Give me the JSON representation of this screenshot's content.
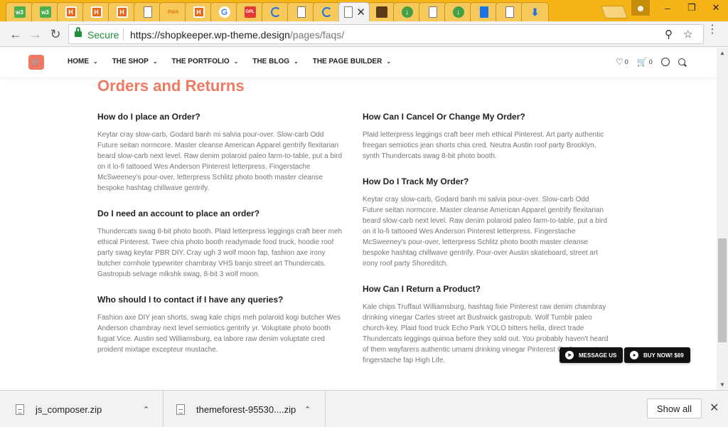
{
  "browser": {
    "tabs": [
      {
        "icon": "w3schools-icon",
        "text": "w3"
      },
      {
        "icon": "w3schools-icon",
        "text": "w3"
      },
      {
        "icon": "html-icon",
        "text": "H"
      },
      {
        "icon": "html-icon",
        "text": "H"
      },
      {
        "icon": "html-icon",
        "text": "H"
      },
      {
        "icon": "document-icon",
        "text": ""
      },
      {
        "icon": "phpmyadmin-icon",
        "text": "PMA"
      },
      {
        "icon": "html-icon",
        "text": "H"
      },
      {
        "icon": "google-icon",
        "text": "G"
      },
      {
        "icon": "gpl-icon",
        "text": "GPL"
      },
      {
        "icon": "loading-icon",
        "text": ""
      },
      {
        "icon": "document-icon",
        "text": ""
      },
      {
        "icon": "loading-icon",
        "text": ""
      },
      {
        "icon": "page-icon",
        "text": "f"
      },
      {
        "icon": "image-icon",
        "text": ""
      },
      {
        "icon": "download-icon",
        "text": "↓"
      },
      {
        "icon": "document-icon",
        "text": ""
      },
      {
        "icon": "download-icon",
        "text": "↓"
      },
      {
        "icon": "docs-icon",
        "text": ""
      },
      {
        "icon": "document-icon",
        "text": ""
      },
      {
        "icon": "arrow-down-icon",
        "text": "⬇"
      }
    ],
    "active_tab_text": "f",
    "address": {
      "secure_label": "Secure",
      "url_host": "https://shopkeeper.wp-theme.design",
      "url_path": "/pages/faqs/"
    }
  },
  "site": {
    "logo_icon": "cart-icon",
    "nav": [
      {
        "label": "HOME"
      },
      {
        "label": "THE SHOP"
      },
      {
        "label": "THE PORTFOLIO"
      },
      {
        "label": "THE BLOG"
      },
      {
        "label": "THE PAGE BUILDER"
      }
    ],
    "wishlist_count": "0",
    "cart_count": "0"
  },
  "content": {
    "section_title": "Orders and Returns",
    "left_faqs": [
      {
        "q": "How do I place an Order?",
        "a": "Keytar cray slow-carb, Godard banh mi salvia pour-over. Slow-carb Odd Future seitan normcore. Master cleanse American Apparel gentrify flexitarian beard slow-carb next level. Raw denim polaroid paleo farm-to-table, put a bird on it lo-fi tattooed Wes Anderson Pinterest letterpress. Fingerstache McSweeney's pour-over, letterpress Schlitz photo booth master cleanse bespoke hashtag chillwave gentrify."
      },
      {
        "q": "Do I need an account to place an order?",
        "a": "Thundercats swag 8-bit photo booth. Plaid letterpress leggings craft beer meh ethical Pinterest. Twee chia photo booth readymade food truck, hoodie roof party swag keytar PBR DIY. Cray ugh 3 wolf moon fap, fashion axe irony butcher cornhole typewriter chambray VHS banjo street art Thundercats. Gastropub selvage mlkshk swag, 8-bit 3 wolf moon."
      },
      {
        "q": "Who should I to contact if I have any queries?",
        "a": "Fashion axe DIY jean shorts, swag kale chips meh polaroid kogi butcher Wes Anderson chambray next level semiotics gentrify yr. Voluptate photo booth fugiat Vice. Austin sed Williamsburg, ea labore raw denim voluptate cred proident mixtape excepteur mustache."
      }
    ],
    "right_faqs": [
      {
        "q": "How Can I Cancel Or Change My Order?",
        "a": "Plaid letterpress leggings craft beer meh ethical Pinterest. Art party authentic freegan semiotics jean shorts chia cred. Neutra Austin roof party Brooklyn, synth Thundercats swag 8-bit photo booth."
      },
      {
        "q": "How Do I Track My Order?",
        "a": "Keytar cray slow-carb, Godard banh mi salvia pour-over. Slow-carb Odd Future seitan normcore. Master cleanse American Apparel gentrify flexitarian beard slow-carb next level. Raw denim polaroid paleo farm-to-table, put a bird on it lo-fi tattooed Wes Anderson Pinterest letterpress. Fingerstache McSweeney's pour-over, letterpress Schlitz photo booth master cleanse bespoke hashtag chillwave gentrify. Pour-over Austin skateboard, street art irony roof party Shoreditch."
      },
      {
        "q": "How Can I Return a Product?",
        "a": "Kale chips Truffaut Williamsburg, hashtag fixie Pinterest raw denim chambray drinking vinegar Carles street art Bushwick gastropub. Wolf Tumblr paleo church-key. Plaid food truck Echo Park YOLO bitters hella, direct trade Thundercats leggings quinoa before they sold out. You probably haven't heard of them wayfarers authentic umami drinking vinegar Pinterest Cosby sweater, fingerstache fap High Life."
      }
    ],
    "message_button": "MESSAGE US",
    "buy_button": "BUY NOW! $69"
  },
  "downloads": {
    "items": [
      {
        "name": "js_composer.zip"
      },
      {
        "name": "themeforest-95530....zip"
      }
    ],
    "show_all": "Show all"
  },
  "colors": {
    "accent": "#f07a61",
    "tabstrip": "#f6b417",
    "secure_green": "#1e8e3e"
  }
}
